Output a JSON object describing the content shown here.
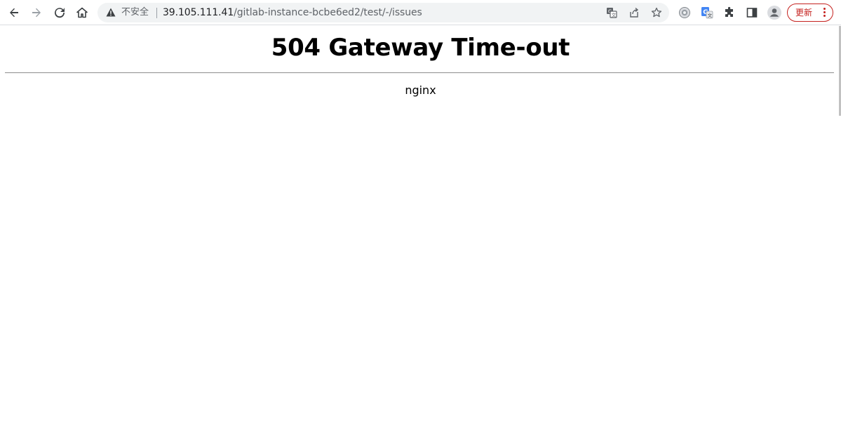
{
  "browser": {
    "security_label": "不安全",
    "url_host": "39.105.111.41",
    "url_path": "/gitlab-instance-bcbe6ed2/test/-/issues",
    "update_label": "更新",
    "accent_color": "#c5221f",
    "icons": [
      "back-icon",
      "forward-icon",
      "reload-icon",
      "home-icon",
      "warning-icon",
      "translate-icon",
      "share-icon",
      "star-icon",
      "extension-icon",
      "google-translate-icon",
      "puzzle-icon",
      "side-panel-icon",
      "profile-icon",
      "menu-dots-icon"
    ]
  },
  "page": {
    "heading": "504 Gateway Time-out",
    "server": "nginx"
  }
}
